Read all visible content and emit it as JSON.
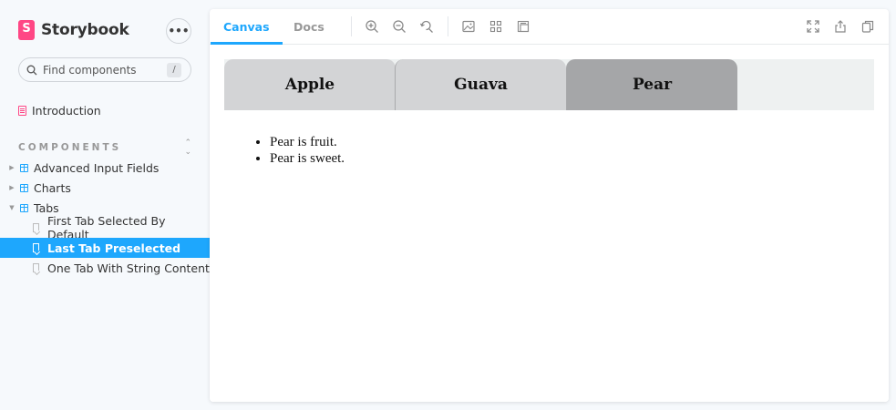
{
  "sidebar": {
    "brand": "Storybook",
    "menu_label": "•••",
    "search": {
      "placeholder": "Find components",
      "shortcut": "/"
    },
    "intro": "Introduction",
    "section_title": "COMPONENTS",
    "section_toggle": "⌃",
    "components": [
      {
        "label": "Advanced Input Fields",
        "expanded": false
      },
      {
        "label": "Charts",
        "expanded": false
      },
      {
        "label": "Tabs",
        "expanded": true
      }
    ],
    "stories": [
      {
        "label": "First Tab Selected By Default",
        "selected": false
      },
      {
        "label": "Last Tab Preselected",
        "selected": true
      },
      {
        "label": "One Tab With String Content",
        "selected": false
      }
    ]
  },
  "toolbar": {
    "tabs": [
      {
        "label": "Canvas",
        "active": true
      },
      {
        "label": "Docs",
        "active": false
      }
    ],
    "tools": [
      "zoom-in-icon",
      "zoom-out-icon",
      "zoom-reset-icon",
      "background-icon",
      "grid-icon",
      "outline-icon"
    ],
    "right_tools": [
      "fullscreen-icon",
      "share-icon",
      "copy-link-icon"
    ]
  },
  "preview": {
    "fruit_tabs": [
      "Apple",
      "Guava",
      "Pear"
    ],
    "selected_tab": "Pear",
    "content_items": [
      "Pear is fruit.",
      "Pear is sweet."
    ]
  },
  "colors": {
    "accent": "#1ea7fd",
    "brand": "#ff4785",
    "selected_tab": "#a5a6a8",
    "tab": "#d3d4d6"
  }
}
